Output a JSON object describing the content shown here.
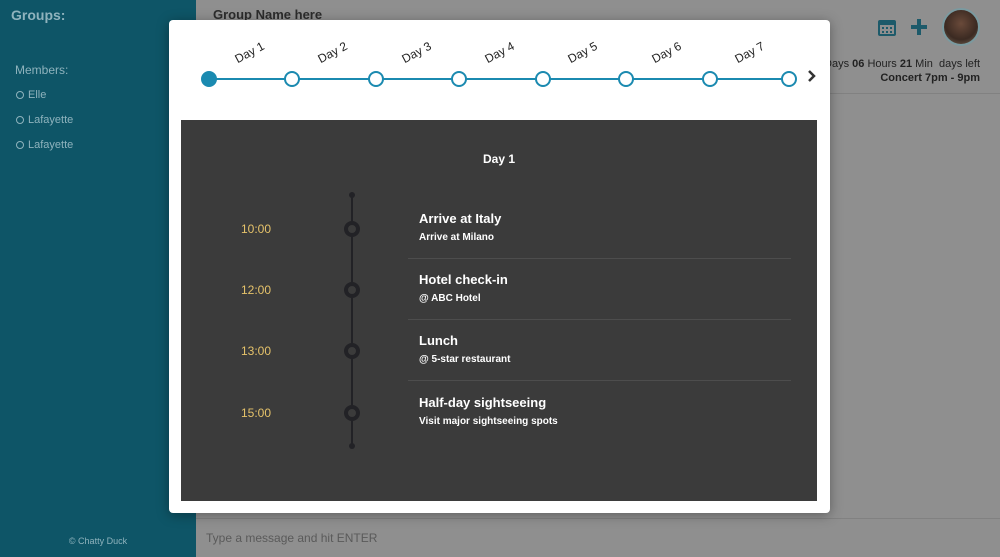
{
  "sidebar": {
    "title": "Groups:",
    "members_label": "Members:",
    "members": [
      "Elle",
      "Lafayette",
      "Lafayette"
    ],
    "copyright": "© Chatty Duck"
  },
  "header": {
    "group_name": "Group Name here",
    "countdown": {
      "line1_prefix": "Days",
      "days": "06",
      "hours_label": "Hours",
      "hours": "21",
      "min_label": "Min",
      "suffix": "days left",
      "event": "Concert 7pm - 9pm"
    },
    "calendar_icon": "calendar-icon",
    "add_icon": "plus-icon"
  },
  "composer": {
    "placeholder": "Type a message and hit ENTER"
  },
  "timeline": {
    "days": [
      "Day 1",
      "Day 2",
      "Day 3",
      "Day 4",
      "Day 5",
      "Day 6",
      "Day 7"
    ],
    "active_index": 0,
    "accent_color": "#1b8ab0",
    "next_icon": "chevron-right-icon"
  },
  "schedule": {
    "day_title": "Day 1",
    "events": [
      {
        "time": "10:00",
        "title": "Arrive at Italy",
        "subtitle": "Arrive at Milano"
      },
      {
        "time": "12:00",
        "title": "Hotel check-in",
        "subtitle": "@ ABC Hotel"
      },
      {
        "time": "13:00",
        "title": "Lunch",
        "subtitle": "@ 5-star restaurant"
      },
      {
        "time": "15:00",
        "title": "Half-day sightseeing",
        "subtitle": "Visit major sightseeing spots"
      }
    ]
  }
}
